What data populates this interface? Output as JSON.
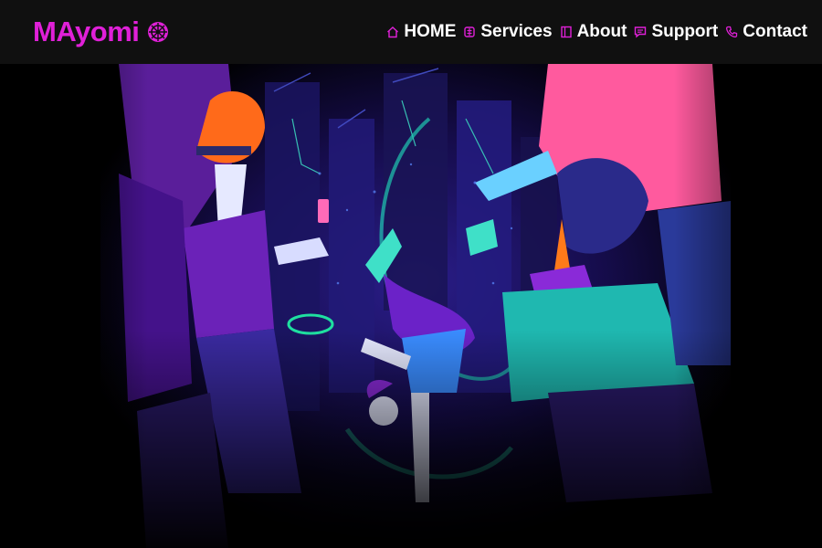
{
  "brand": {
    "name": "MAyomi",
    "icon": "helm-wheel-icon",
    "color": "#e020d8"
  },
  "nav": {
    "items": [
      {
        "label": "HOME",
        "icon": "home-icon"
      },
      {
        "label": "Services",
        "icon": "services-icon"
      },
      {
        "label": "About",
        "icon": "book-icon"
      },
      {
        "label": "Support",
        "icon": "chat-icon"
      },
      {
        "label": "Contact",
        "icon": "phone-icon"
      }
    ],
    "icon_color": "#e020d8",
    "label_color": "#ffffff"
  },
  "hero": {
    "image": "street-dance-illustration",
    "background": "#000000",
    "accent_colors": [
      "#6a1fc4",
      "#ff5a9e",
      "#1fc8b0",
      "#ff7a1a",
      "#3a8cff"
    ]
  }
}
